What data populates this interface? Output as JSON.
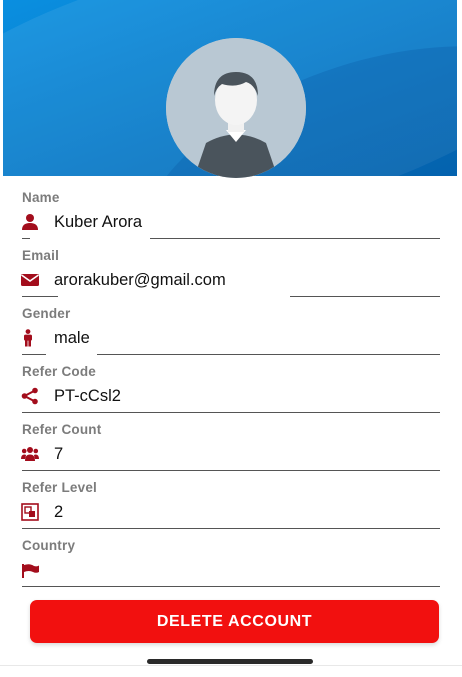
{
  "profile": {
    "avatar_icon": "default-user-avatar",
    "header_color": "#0679c8"
  },
  "fields": [
    {
      "key": "name",
      "label": "Name",
      "value": "Kuber Arora",
      "icon": "user-icon"
    },
    {
      "key": "email",
      "label": "Email",
      "value": "arorakuber@gmail.com",
      "icon": "envelope-icon"
    },
    {
      "key": "gender",
      "label": "Gender",
      "value": "male",
      "icon": "male-icon"
    },
    {
      "key": "refer_code",
      "label": "Refer Code",
      "value": "PT-cCsl2",
      "icon": "share-icon"
    },
    {
      "key": "refer_count",
      "label": "Refer Count",
      "value": "7",
      "icon": "users-icon"
    },
    {
      "key": "refer_level",
      "label": "Refer Level",
      "value": "2",
      "icon": "level-icon"
    },
    {
      "key": "country",
      "label": "Country",
      "value": "",
      "icon": "flag-icon"
    }
  ],
  "actions": {
    "delete_label": "DELETE ACCOUNT",
    "delete_color": "#f2100f"
  },
  "colors": {
    "icon": "#a30d1c",
    "label": "#7c7c7c"
  }
}
